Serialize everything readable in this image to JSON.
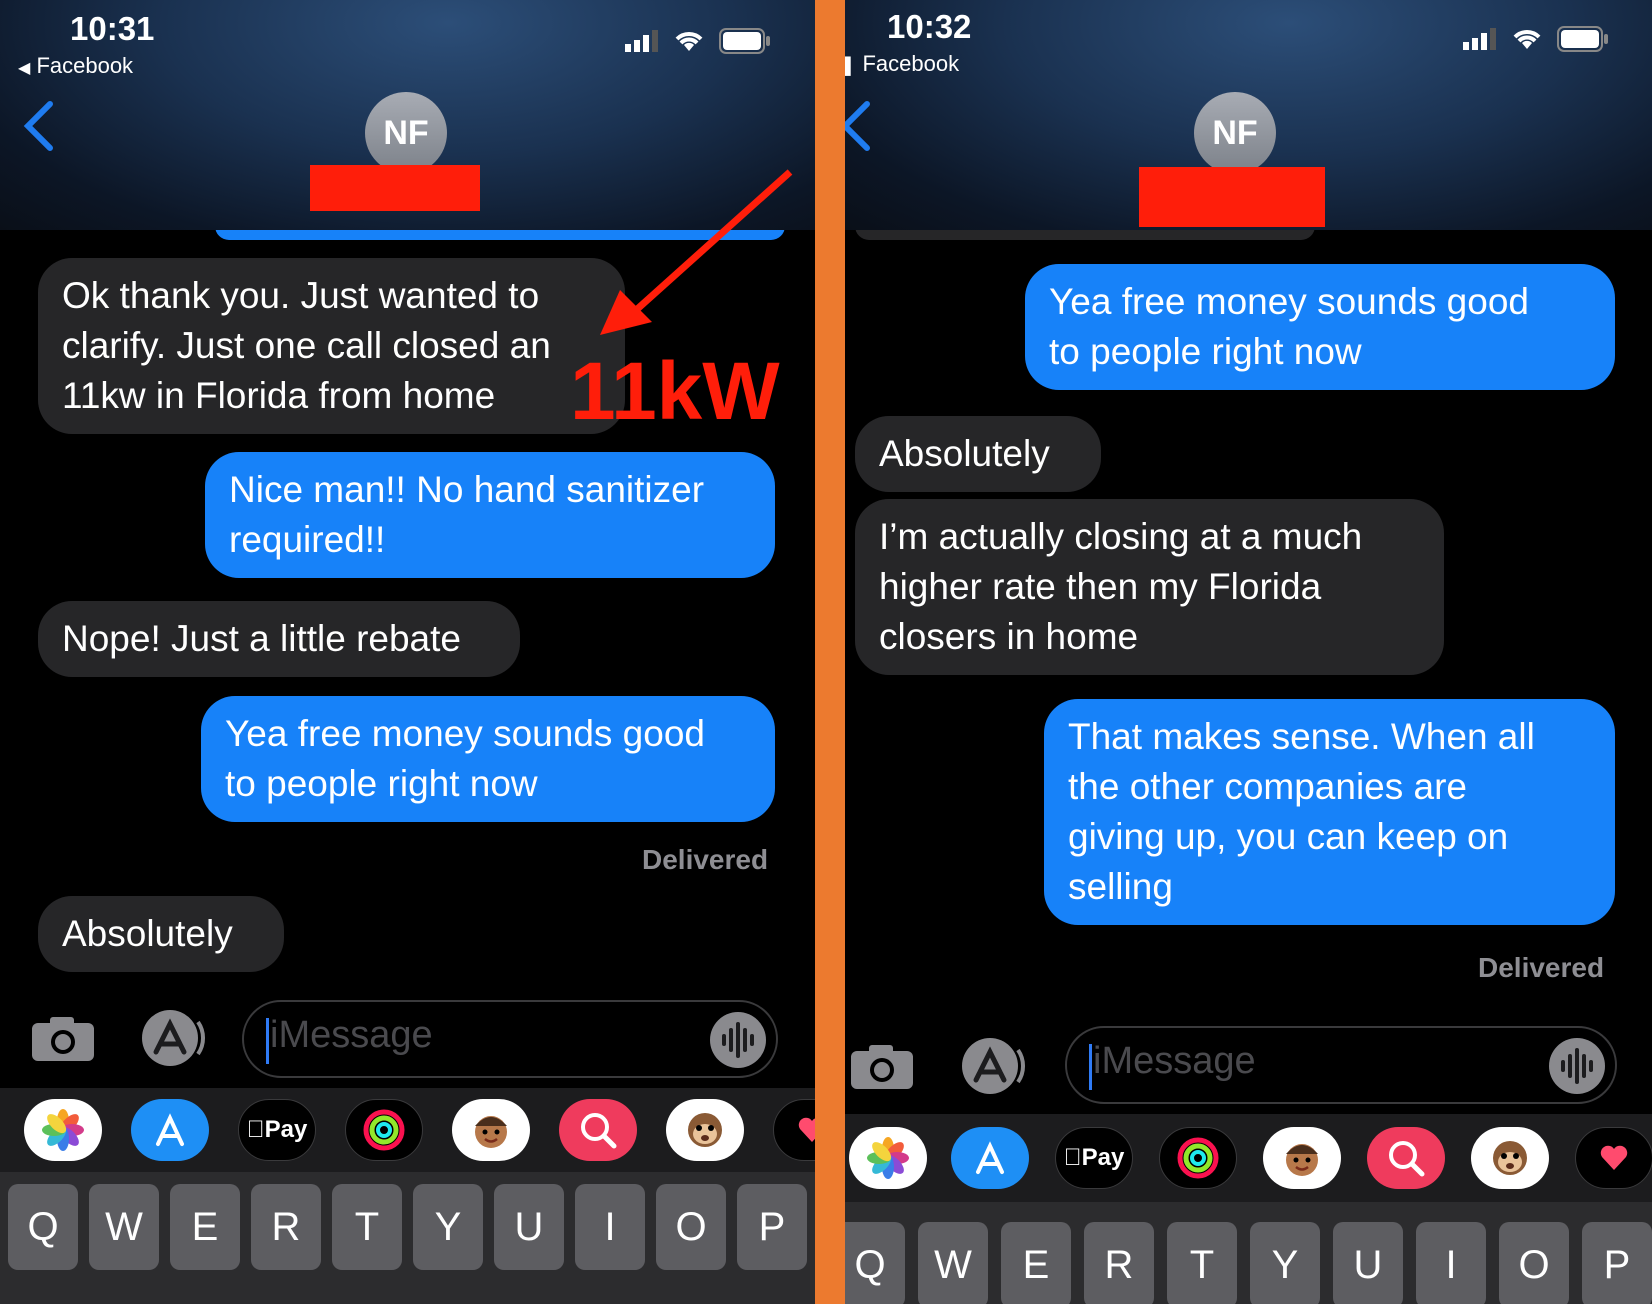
{
  "left": {
    "time": "10:31",
    "back_app": "Facebook",
    "avatar_initials": "NF",
    "messages": [
      {
        "dir": "in",
        "text": "Ok thank you. Just wanted to clarify. Just one call closed an 11kw in Florida from home",
        "lines": [
          "Ok thank you. Just wanted to",
          "clarify. Just one call closed an",
          "11kw in Florida from home"
        ]
      },
      {
        "dir": "out",
        "lines": [
          "Nice man!! No hand sanitizer",
          "required!!"
        ]
      },
      {
        "dir": "in",
        "lines": [
          "Nope! Just a little rebate"
        ]
      },
      {
        "dir": "out",
        "lines": [
          "Yea free money sounds good",
          "to people right now"
        ]
      },
      {
        "dir": "in",
        "lines": [
          "Absolutely"
        ]
      }
    ],
    "delivered": "Delivered",
    "annotation": "11kW",
    "input_placeholder": "iMessage"
  },
  "right": {
    "time": "10:32",
    "back_app": "Facebook",
    "avatar_initials": "NF",
    "messages": [
      {
        "dir": "out",
        "lines": [
          "Yea free money sounds good",
          "to people right now"
        ]
      },
      {
        "dir": "in",
        "lines": [
          "Absolutely"
        ]
      },
      {
        "dir": "in",
        "lines": [
          "I’m actually closing at a much",
          "higher rate then my Florida",
          "closers in home"
        ]
      },
      {
        "dir": "out",
        "lines": [
          "That makes sense. When all",
          "the other companies are",
          "giving up, you can keep on",
          "selling"
        ]
      }
    ],
    "delivered": "Delivered",
    "input_placeholder": "iMessage"
  },
  "apps": [
    {
      "name": "photos-app-icon",
      "label": ""
    },
    {
      "name": "app-store-app-icon",
      "label": ""
    },
    {
      "name": "apple-pay-app-icon",
      "label": "Pay"
    },
    {
      "name": "activity-app-icon",
      "label": ""
    },
    {
      "name": "memoji-app-icon",
      "label": ""
    },
    {
      "name": "web-search-app-icon",
      "label": ""
    },
    {
      "name": "animoji-monkey-app-icon",
      "label": ""
    },
    {
      "name": "digital-touch-app-icon",
      "label": ""
    }
  ],
  "keys": [
    "Q",
    "W",
    "E",
    "R",
    "T",
    "Y",
    "U",
    "I",
    "O",
    "P"
  ],
  "colors": {
    "redaction": "#ff1e0a",
    "divider": "#ec7a2f",
    "outgoing": "#1782f9",
    "incoming": "#262628"
  }
}
